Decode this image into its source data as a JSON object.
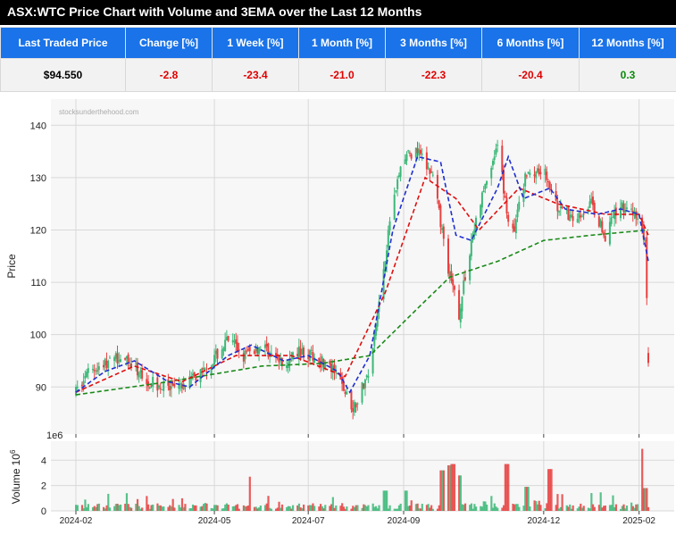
{
  "page": {
    "title": "ASX:WTC Price Chart with Volume and 3EMA over the Last 12 Months"
  },
  "stats_table": {
    "headers": [
      "Last Traded Price",
      "Change [%]",
      "1 Week [%]",
      "1 Month [%]",
      "3 Months [%]",
      "6 Months [%]",
      "12 Months [%]"
    ],
    "values": [
      "$94.550",
      "-2.8",
      "-23.4",
      "-21.0",
      "-22.3",
      "-20.4",
      "0.3"
    ],
    "value_colors": [
      "#000000",
      "#e00000",
      "#e00000",
      "#e00000",
      "#e00000",
      "#e00000",
      "#0a8a0a"
    ]
  },
  "chart_data": [
    {
      "type": "candlestick",
      "watermark": "stocksunderthehood.com",
      "ylabel": "Price",
      "ylim": [
        81,
        145
      ],
      "yticks": [
        90,
        100,
        110,
        120,
        130,
        140
      ],
      "xticks": [
        "2024-02",
        "2024-05",
        "2024-07",
        "2024-09",
        "2024-12",
        "2025-02"
      ],
      "xtick_dates": [
        "2024-02-01",
        "2024-05-01",
        "2024-07-01",
        "2024-09-01",
        "2024-12-01",
        "2025-02-01"
      ],
      "grid": true,
      "colors": {
        "up": "#3cb878",
        "down": "#e84040",
        "ema_short": "#1f2fd0",
        "ema_mid": "#e01010",
        "ema_long": "#1a8a1a"
      },
      "price_keypoints": [
        [
          "2024-02-01",
          89
        ],
        [
          "2024-02-10",
          93
        ],
        [
          "2024-03-01",
          96
        ],
        [
          "2024-03-20",
          91
        ],
        [
          "2024-04-05",
          89
        ],
        [
          "2024-04-25",
          93
        ],
        [
          "2024-05-10",
          99
        ],
        [
          "2024-05-20",
          96
        ],
        [
          "2024-06-01",
          98
        ],
        [
          "2024-06-15",
          94
        ],
        [
          "2024-06-25",
          97
        ],
        [
          "2024-07-10",
          95
        ],
        [
          "2024-07-20",
          92
        ],
        [
          "2024-07-30",
          86
        ],
        [
          "2024-08-10",
          93
        ],
        [
          "2024-08-20",
          115
        ],
        [
          "2024-08-25",
          126
        ],
        [
          "2024-09-01",
          134
        ],
        [
          "2024-09-10",
          135
        ],
        [
          "2024-09-20",
          130
        ],
        [
          "2024-10-01",
          111
        ],
        [
          "2024-10-07",
          104
        ],
        [
          "2024-10-15",
          118
        ],
        [
          "2024-10-25",
          130
        ],
        [
          "2024-11-01",
          136
        ],
        [
          "2024-11-10",
          118
        ],
        [
          "2024-11-20",
          131
        ],
        [
          "2024-12-01",
          132
        ],
        [
          "2024-12-10",
          124
        ],
        [
          "2024-12-20",
          122
        ],
        [
          "2025-01-01",
          125
        ],
        [
          "2025-01-10",
          119
        ],
        [
          "2025-01-20",
          125
        ],
        [
          "2025-02-01",
          122
        ],
        [
          "2025-02-05",
          118
        ],
        [
          "2025-02-07",
          96
        ]
      ],
      "ema_short_keypoints": [
        [
          "2024-02-01",
          89
        ],
        [
          "2024-02-20",
          93
        ],
        [
          "2024-03-10",
          95
        ],
        [
          "2024-04-01",
          91
        ],
        [
          "2024-04-15",
          90
        ],
        [
          "2024-05-10",
          96
        ],
        [
          "2024-05-25",
          98
        ],
        [
          "2024-06-15",
          95
        ],
        [
          "2024-07-01",
          96
        ],
        [
          "2024-07-20",
          93
        ],
        [
          "2024-07-28",
          89
        ],
        [
          "2024-08-10",
          96
        ],
        [
          "2024-08-25",
          120
        ],
        [
          "2024-09-10",
          134
        ],
        [
          "2024-09-25",
          133
        ],
        [
          "2024-10-05",
          119
        ],
        [
          "2024-10-15",
          118
        ],
        [
          "2024-11-01",
          128
        ],
        [
          "2024-11-08",
          134
        ],
        [
          "2024-11-18",
          126
        ],
        [
          "2024-12-05",
          128
        ],
        [
          "2024-12-15",
          124
        ],
        [
          "2025-01-05",
          123
        ],
        [
          "2025-01-20",
          124
        ],
        [
          "2025-02-01",
          123
        ],
        [
          "2025-02-07",
          114
        ]
      ],
      "ema_mid_keypoints": [
        [
          "2024-02-01",
          89
        ],
        [
          "2024-03-10",
          94
        ],
        [
          "2024-04-10",
          91
        ],
        [
          "2024-05-15",
          96
        ],
        [
          "2024-06-20",
          96
        ],
        [
          "2024-07-25",
          92
        ],
        [
          "2024-08-20",
          108
        ],
        [
          "2024-09-15",
          130
        ],
        [
          "2024-10-05",
          126
        ],
        [
          "2024-10-20",
          120
        ],
        [
          "2024-11-15",
          128
        ],
        [
          "2024-12-10",
          125
        ],
        [
          "2025-01-10",
          123
        ],
        [
          "2025-02-01",
          123
        ],
        [
          "2025-02-07",
          119
        ]
      ],
      "ema_long_keypoints": [
        [
          "2024-02-01",
          88.5
        ],
        [
          "2024-04-01",
          91
        ],
        [
          "2024-06-01",
          94
        ],
        [
          "2024-07-10",
          94.5
        ],
        [
          "2024-08-10",
          96
        ],
        [
          "2024-09-10",
          105
        ],
        [
          "2024-10-01",
          111
        ],
        [
          "2024-11-01",
          114
        ],
        [
          "2024-12-01",
          118
        ],
        [
          "2025-01-01",
          119
        ],
        [
          "2025-02-07",
          120
        ]
      ]
    },
    {
      "type": "bar",
      "ylabel": "Volume",
      "ylabel_exp": "6",
      "scale_label": "1e6",
      "ylim": [
        0,
        5.5
      ],
      "yticks": [
        0,
        2,
        4
      ],
      "xticks": [
        "2024-02",
        "2024-05",
        "2024-07",
        "2024-09",
        "2024-12",
        "2025-02"
      ],
      "xtick_dates": [
        "2024-02-01",
        "2024-05-01",
        "2024-07-01",
        "2024-09-01",
        "2024-12-01",
        "2025-02-01"
      ],
      "volume_spikes": [
        [
          "2024-05-25",
          2.7
        ],
        [
          "2024-09-26",
          3.2
        ],
        [
          "2024-09-30",
          3.6
        ],
        [
          "2024-10-03",
          3.7
        ],
        [
          "2024-10-07",
          2.8
        ],
        [
          "2024-11-07",
          3.7
        ],
        [
          "2024-12-05",
          3.3
        ],
        [
          "2024-11-20",
          1.9
        ],
        [
          "2025-02-03",
          4.9
        ],
        [
          "2025-02-05",
          1.8
        ],
        [
          "2024-08-20",
          1.6
        ],
        [
          "2024-09-02",
          1.6
        ]
      ]
    }
  ]
}
